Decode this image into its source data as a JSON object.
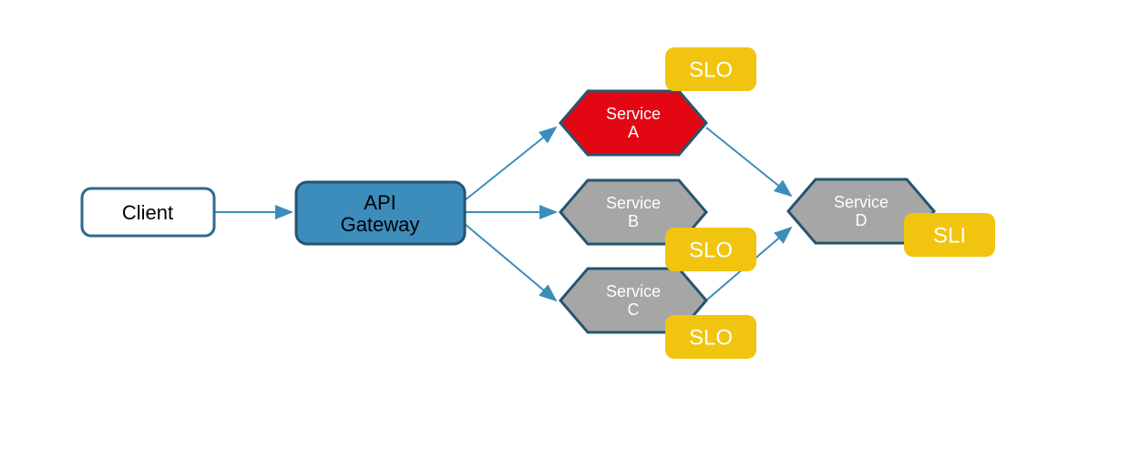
{
  "diagram": {
    "client": {
      "label": "Client"
    },
    "gateway": {
      "label_line1": "API",
      "label_line2": "Gateway"
    },
    "serviceA": {
      "label_line1": "Service",
      "label_line2": "A"
    },
    "serviceB": {
      "label_line1": "Service",
      "label_line2": "B"
    },
    "serviceC": {
      "label_line1": "Service",
      "label_line2": "C"
    },
    "serviceD": {
      "label_line1": "Service",
      "label_line2": "D"
    },
    "badgeA": {
      "label": "SLO"
    },
    "badgeB": {
      "label": "SLO"
    },
    "badgeC": {
      "label": "SLO"
    },
    "badgeD": {
      "label": "SLI"
    },
    "colors": {
      "client_fill": "#ffffff",
      "gateway_fill": "#3c8dbc",
      "service_gray": "#a6a6a6",
      "service_red": "#e30613",
      "badge": "#f1c40f",
      "stroke": "#25556f",
      "arrow": "#3c8dbc"
    }
  }
}
